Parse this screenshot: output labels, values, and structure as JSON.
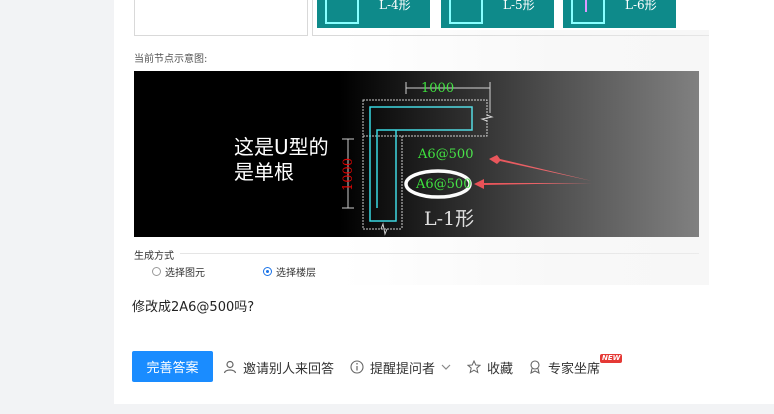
{
  "thumbnails": [
    {
      "label": "L-4形"
    },
    {
      "label": "L-5形"
    },
    {
      "label": "L-6形"
    }
  ],
  "screenshot": {
    "caption": "当前节点示意图:",
    "cad": {
      "dim_top": "1000",
      "dim_left": "1000",
      "spec_top": "A6@500",
      "spec_circled": "A6@500",
      "shape_label": "L-1形",
      "annotation_line1": "这是U型的",
      "annotation_line2": "是单根"
    },
    "section_title": "生成方式",
    "radio_options": [
      {
        "label": "选择图元",
        "selected": false
      },
      {
        "label": "选择楼层",
        "selected": true
      }
    ]
  },
  "question_text": "修改成2A6@500吗?",
  "actions": {
    "primary_label": "完善答案",
    "invite_label": "邀请别人来回答",
    "remind_label": "提醒提问者",
    "favorite_label": "收藏",
    "expert_label": "专家坐席",
    "new_badge": "NEW"
  },
  "colors": {
    "primary": "#1a8cff",
    "cad_background": "#000000",
    "thumb_teal": "#0e8a8a",
    "arrow_red": "#e8262d",
    "dim_green": "#22e022",
    "rebar_cyan": "#2ed6e0",
    "dim_red": "#e00000"
  }
}
